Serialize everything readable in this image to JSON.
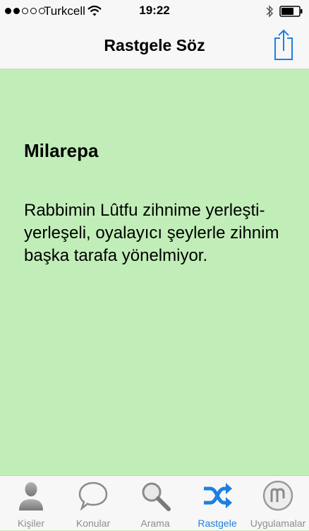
{
  "status_bar": {
    "carrier": "Turkcell",
    "time": "19:22"
  },
  "nav": {
    "title": "Rastgele Söz"
  },
  "quote": {
    "author": "Milarepa",
    "text": "Rabbimin Lûtfu zihnime yerleşti-yerleşeli, oyalayıcı şeylerle zihnim başka tarafa yönelmiyor."
  },
  "tabs": [
    {
      "label": "Kişiler",
      "icon": "person-icon"
    },
    {
      "label": "Konular",
      "icon": "speech-bubble-icon"
    },
    {
      "label": "Arama",
      "icon": "magnifier-icon"
    },
    {
      "label": "Rastgele",
      "icon": "shuffle-icon",
      "active": true
    },
    {
      "label": "Uygulamalar",
      "icon": "apps-icon"
    }
  ],
  "colors": {
    "accent": "#1f7fe0",
    "content_bg": "#c1eeb8",
    "bar_bg": "#f7f7f7",
    "inactive": "#8e8e8e"
  }
}
